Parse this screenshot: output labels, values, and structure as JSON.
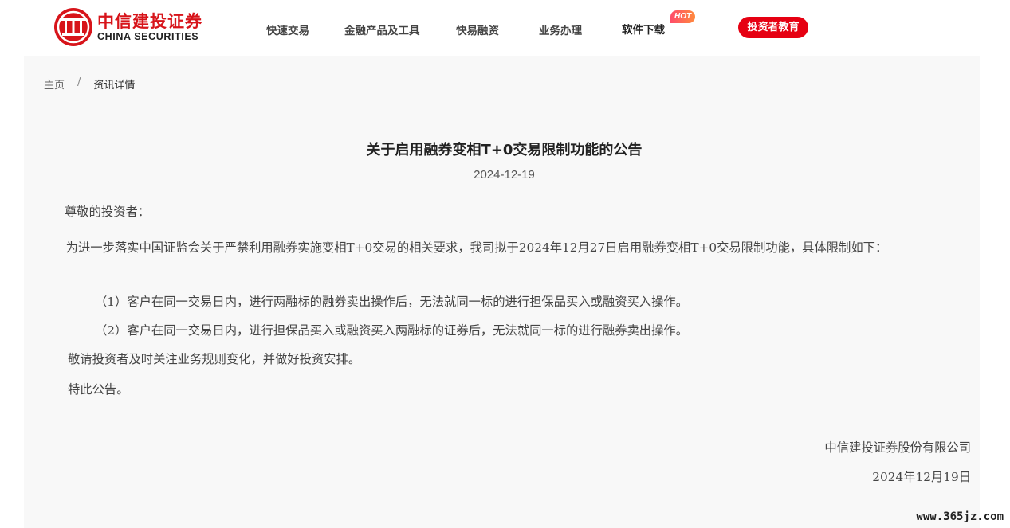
{
  "header": {
    "logo_cn": "中信建投证券",
    "logo_en": "CHINA SECURITIES",
    "nav": [
      {
        "label": "快速交易"
      },
      {
        "label": "金融产品及工具"
      },
      {
        "label": "快易融资"
      },
      {
        "label": "业务办理"
      },
      {
        "label": "软件下载",
        "badge": "HOT"
      }
    ],
    "edu_button": "投资者教育"
  },
  "breadcrumb": {
    "home": "主页",
    "separator": "/",
    "current": "资讯详情"
  },
  "article": {
    "title": "关于启用融券变相T+0交易限制功能的公告",
    "date": "2024-12-19",
    "greeting": "尊敬的投资者：",
    "intro": "为进一步落实中国证监会关于严禁利用融券实施变相T+0交易的相关要求，我司拟于2024年12月27日启用融券变相T+0交易限制功能，具体限制如下：",
    "items": [
      "（1）客户在同一交易日内，进行两融标的融券卖出操作后，无法就同一标的进行担保品买入或融资买入操作。",
      "（2）客户在同一交易日内，进行担保品买入或融资买入两融标的证券后，无法就同一标的进行融券卖出操作。"
    ],
    "reminder": "敬请投资者及时关注业务规则变化，并做好投资安排。",
    "closing": "特此公告。",
    "signature_company": "中信建投证券股份有限公司",
    "signature_date": "2024年12月19日"
  },
  "watermark": "www.365jz.com",
  "colors": {
    "brand_red": "#d7141a",
    "edu_button": "#e60012",
    "content_bg": "#f8f8f8"
  }
}
